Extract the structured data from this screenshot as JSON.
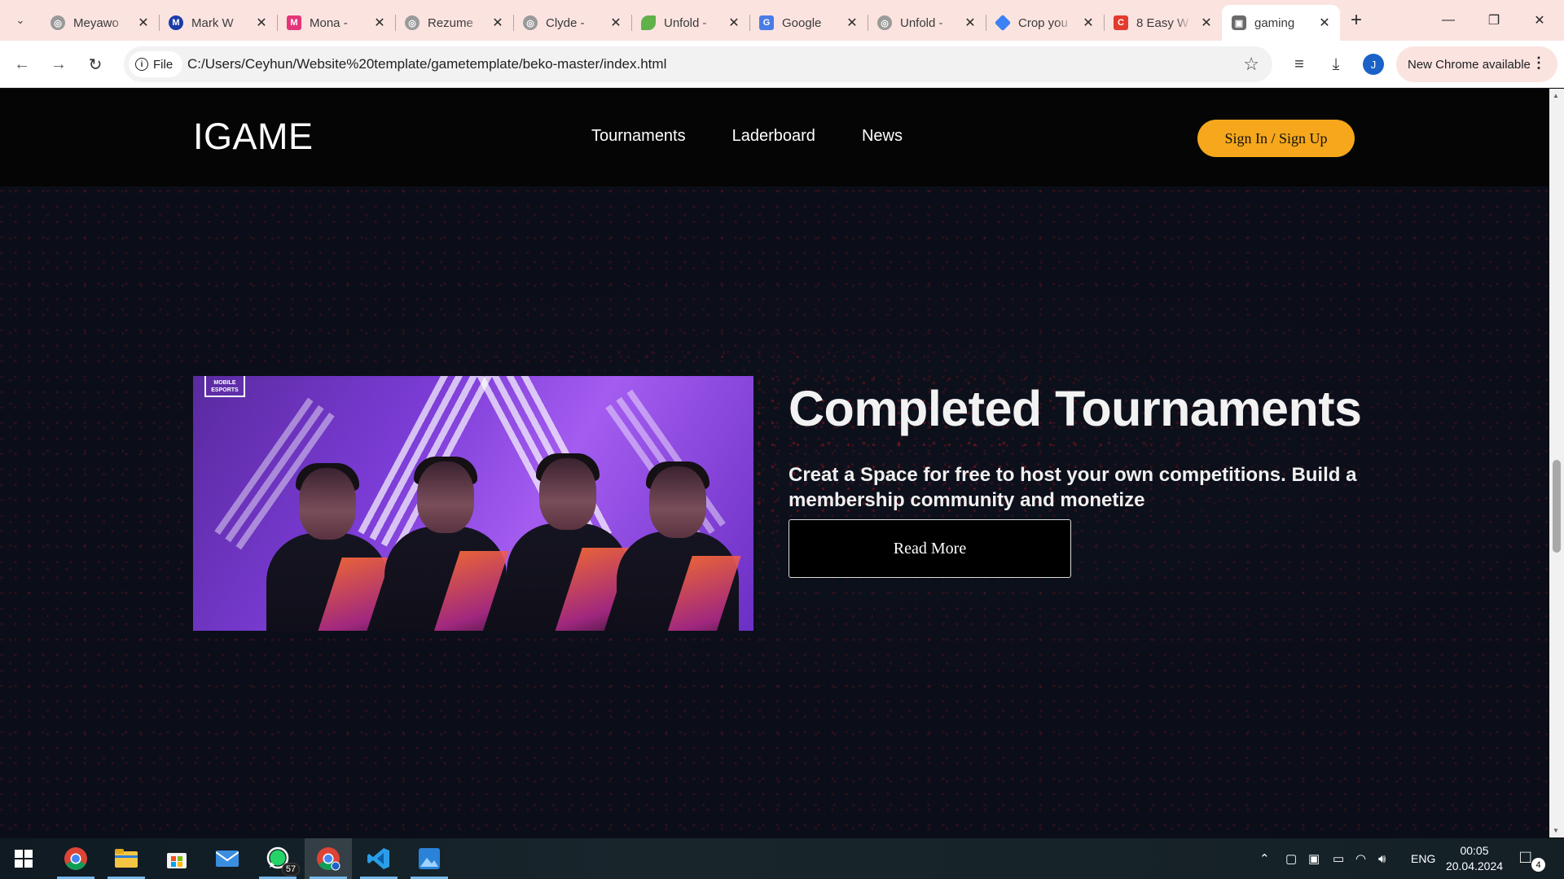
{
  "browser": {
    "tabs": [
      {
        "title": "Meyawo",
        "favicon": "globe-icon",
        "color": "#8a8a8a"
      },
      {
        "title": "Mark W",
        "favicon": "m-blue-icon",
        "color": "#1a3ca8"
      },
      {
        "title": "Mona -",
        "favicon": "m-pink-icon",
        "color": "#e5357a"
      },
      {
        "title": "Rezume",
        "favicon": "globe-icon",
        "color": "#8a8a8a"
      },
      {
        "title": "Clyde -",
        "favicon": "globe-icon",
        "color": "#8a8a8a"
      },
      {
        "title": "Unfold -",
        "favicon": "leaf-icon",
        "color": "#5fb14a"
      },
      {
        "title": "Google",
        "favicon": "google-translate-icon",
        "color": "#4b7be5"
      },
      {
        "title": "Unfold -",
        "favicon": "globe-icon",
        "color": "#8a8a8a"
      },
      {
        "title": "Crop you",
        "favicon": "gem-icon",
        "color": "#3b82f6"
      },
      {
        "title": "8 Easy W",
        "favicon": "c-red-icon",
        "color": "#e23b2e"
      },
      {
        "title": "gaming",
        "favicon": "controller-icon",
        "color": "#666666",
        "active": true
      }
    ],
    "address": {
      "scheme_chip": "File",
      "url": "C:/Users/Ceyhun/Website%20template/gametemplate/beko-master/index.html"
    },
    "profile_initial": "J",
    "update_label": "New Chrome available"
  },
  "site": {
    "logo": "IGAME",
    "nav": [
      "Tournaments",
      "Laderboard",
      "News"
    ],
    "signin_label": "Sign In / Sign Up",
    "hero": {
      "image_badge": "MOBILE ESPORTS",
      "title": "Completed Tournaments",
      "subtitle": "Creat a Space for free to host your own competitions. Build a membership community and monetize",
      "button_label": "Read More"
    },
    "accent_color": "#f6a71b"
  },
  "taskbar": {
    "apps": [
      {
        "name": "chrome",
        "running": true
      },
      {
        "name": "file-explorer",
        "running": true
      },
      {
        "name": "microsoft-store",
        "running": false
      },
      {
        "name": "mail",
        "running": false
      },
      {
        "name": "whatsapp",
        "running": true,
        "badge": "57"
      },
      {
        "name": "chrome-profile",
        "running": true,
        "current": true
      },
      {
        "name": "vscode",
        "running": true
      },
      {
        "name": "photos",
        "running": true
      }
    ],
    "language": "ENG",
    "time": "00:05",
    "date": "20.04.2024",
    "notification_count": "4"
  }
}
